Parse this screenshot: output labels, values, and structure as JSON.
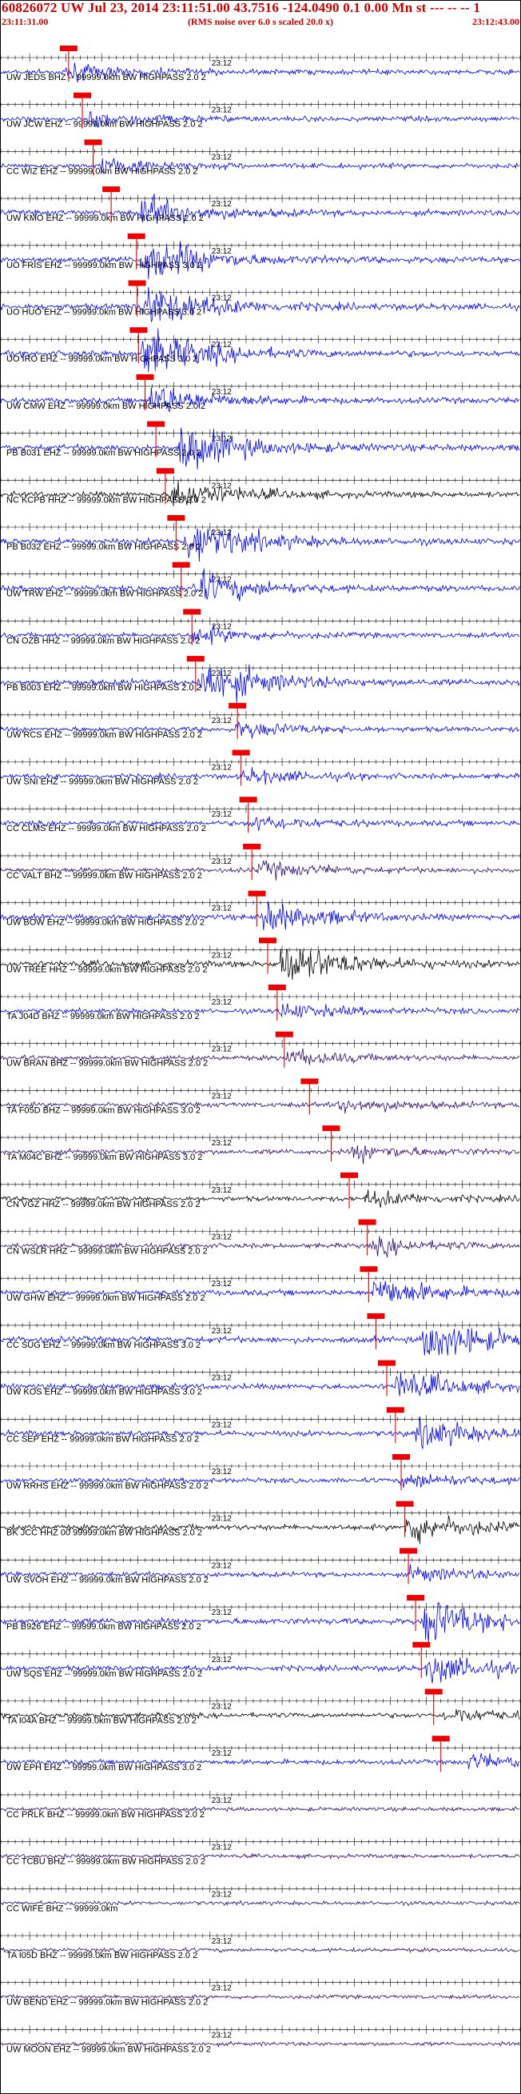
{
  "header": {
    "title": "60826072  UW  Jul 23, 2014 23:11:51.00    43.7516  -124.0490   0.1  0.00  Mn st  ---  --  --  1",
    "start_time": "23:11:31.00",
    "end_time": "23:12:43.00",
    "rms_note": "(RMS noise over 6.0 s scaled 20.0 x)"
  },
  "minute_label": "23:12",
  "colors": {
    "blue": "#0000ee",
    "black": "#000000",
    "purple": "#2a0a6a",
    "pick": "#ee0000",
    "label": "#000000"
  },
  "chart_data": {
    "type": "seismogram record section",
    "x_unit": "time (UTC)",
    "x_range": [
      "23:11:31.00",
      "23:12:43.00"
    ],
    "traces": [
      {
        "label": "UW JEDS BHZ -- 99999.0km BW  HIGHPASS  2.0  2",
        "color": "blue",
        "pick_time": "23:11:40.4",
        "amplitude": "low",
        "burst_time": "23:11:40.4"
      },
      {
        "label": "UW JCW  EHZ -- 99999.0km BW  HIGHPASS  2.0  2",
        "color": "blue",
        "pick_time": "23:11:42.3",
        "amplitude": "low",
        "burst_time": "23:11:43.5"
      },
      {
        "label": "CC WIZ  EHZ -- 99999.0km BW  HIGHPASS  2.0  2",
        "color": "blue",
        "pick_time": "23:11:43.8",
        "amplitude": "low",
        "burst_time": "23:11:45.0"
      },
      {
        "label": "UW KMO  EHZ -- 99999.0km BW  HIGHPASS  2.0  2",
        "color": "blue",
        "pick_time": "23:11:46.3",
        "amplitude": "medium",
        "burst_time": "23:11:50.8"
      },
      {
        "label": "UO FRIS EHZ -- 99999.0km BW  HIGHPASS  3.0  2",
        "color": "blue",
        "pick_time": "23:11:49.8",
        "amplitude": "high",
        "burst_time": "23:11:51.0"
      },
      {
        "label": "UO HUO  EHZ -- 99999.0km BW  HIGHPASS  3.0  2",
        "color": "blue",
        "pick_time": "23:11:49.9",
        "amplitude": "high",
        "burst_time": "23:11:51.0"
      },
      {
        "label": "UO IRO  EHZ -- 99999.0km BW  HIGHPASS  3.0  2",
        "color": "blue",
        "pick_time": "23:11:50.1",
        "amplitude": "high",
        "burst_time": "23:11:51.0"
      },
      {
        "label": "UW CMW  EHZ -- 99999.0km BW  HIGHPASS  2.0  2",
        "color": "blue",
        "pick_time": "23:11:51.0",
        "amplitude": "medium",
        "burst_time": "23:11:52.0"
      },
      {
        "label": "PB B031 EHZ -- 99999.0km BW  HIGHPASS  2.0  2",
        "color": "blue",
        "pick_time": "23:11:52.5",
        "amplitude": "high",
        "burst_time": "23:11:56.0"
      },
      {
        "label": "NC KCPB HHZ -- 99999.0km BW  HIGHPASS  2.0  2",
        "color": "black",
        "pick_time": "23:11:53.8",
        "amplitude": "medium",
        "burst_time": "23:11:55.0"
      },
      {
        "label": "PB B032 EHZ -- 99999.0km BW  HIGHPASS  2.0  2",
        "color": "blue",
        "pick_time": "23:11:55.3",
        "amplitude": "high",
        "burst_time": "23:11:57.0"
      },
      {
        "label": "UW TRW  EHZ -- 99999.0km BW  HIGHPASS  2.0  2",
        "color": "blue",
        "pick_time": "23:11:56.0",
        "amplitude": "medium",
        "burst_time": "23:11:58.0"
      },
      {
        "label": "CN OZB  HHZ -- 99999.0km BW  HIGHPASS  2.0  2",
        "color": "blue",
        "pick_time": "23:11:57.5",
        "amplitude": "low",
        "burst_time": "23:11:58.0"
      },
      {
        "label": "PB B003 EHZ -- 99999.0km BW  HIGHPASS  2.0  2",
        "color": "blue",
        "pick_time": "23:11:58.0",
        "amplitude": "high",
        "burst_time": "23:11:59.0"
      },
      {
        "label": "UW RCS  EHZ -- 99999.0km BW  HIGHPASS  2.0  2",
        "color": "blue",
        "pick_time": "23:12:03.8",
        "amplitude": "low",
        "burst_time": "23:12:04.0"
      },
      {
        "label": "UW SNI  EHZ -- 99999.0km BW  HIGHPASS  2.0  2",
        "color": "blue",
        "pick_time": "23:12:04.3",
        "amplitude": "low",
        "burst_time": "23:12:05.0"
      },
      {
        "label": "CC CLMS EHZ -- 99999.0km BW  HIGHPASS  2.0  2",
        "color": "blue",
        "pick_time": "23:12:05.3",
        "amplitude": "low",
        "burst_time": "23:12:06.0"
      },
      {
        "label": "CC VALT BHZ -- 99999.0km BW  HIGHPASS  2.0  2",
        "color": "purple",
        "pick_time": "23:12:05.8",
        "amplitude": "low",
        "burst_time": "23:12:07.0"
      },
      {
        "label": "UW BOW  EHZ -- 99999.0km BW  HIGHPASS  2.0  2",
        "color": "blue",
        "pick_time": "23:12:06.5",
        "amplitude": "medium",
        "burst_time": "23:12:07.5"
      },
      {
        "label": "UW TREE HHZ -- 99999.0km BW  HIGHPASS  2.0  2",
        "color": "black",
        "pick_time": "23:12:08.0",
        "amplitude": "high",
        "burst_time": "23:12:10.0"
      },
      {
        "label": "TA J04D BHZ -- 99999.0km BW  HIGHPASS  2.0  2",
        "color": "blue",
        "pick_time": "23:12:09.3",
        "amplitude": "low",
        "burst_time": "23:12:10.0"
      },
      {
        "label": "UW BRAN BHZ -- 99999.0km BW  HIGHPASS  2.0  2",
        "color": "purple",
        "pick_time": "23:12:10.3",
        "amplitude": "low",
        "burst_time": "23:12:11.0"
      },
      {
        "label": "TA F05D BHZ -- 99999.0km BW  HIGHPASS  3.0  2",
        "color": "purple",
        "pick_time": "23:12:13.8",
        "amplitude": "low",
        "burst_time": "23:12:18.0"
      },
      {
        "label": "TA M04C BHZ -- 99999.0km BW  HIGHPASS  3.0  2",
        "color": "purple",
        "pick_time": "23:12:16.8",
        "amplitude": "low",
        "burst_time": "23:12:20.0"
      },
      {
        "label": "CN VGZ  HHZ -- 99999.0km BW  HIGHPASS  2.0  2",
        "color": "black",
        "pick_time": "23:12:19.3",
        "amplitude": "low",
        "burst_time": "23:12:22.0"
      },
      {
        "label": "CN WSLR HHZ -- 99999.0km BW  HIGHPASS  2.0  2",
        "color": "purple",
        "pick_time": "23:12:21.8",
        "amplitude": "low",
        "burst_time": "23:12:23.0"
      },
      {
        "label": "UW GHW  EHZ -- 99999.0km BW  HIGHPASS  2.0  2",
        "color": "blue",
        "pick_time": "23:12:22.0",
        "amplitude": "medium",
        "burst_time": "23:12:23.0"
      },
      {
        "label": "CC SUG  EHZ -- 99999.0km BW  HIGHPASS  3.0  2",
        "color": "blue",
        "pick_time": "23:12:23.0",
        "amplitude": "high",
        "burst_time": "23:12:30.0"
      },
      {
        "label": "UW KOS  EHZ -- 99999.0km BW  HIGHPASS  3.0  2",
        "color": "blue",
        "pick_time": "23:12:24.5",
        "amplitude": "medium",
        "burst_time": "23:12:26.0"
      },
      {
        "label": "CC SEP  EHZ -- 99999.0km BW  HIGHPASS  2.0  2",
        "color": "blue",
        "pick_time": "23:12:25.7",
        "amplitude": "medium",
        "burst_time": "23:12:29.0"
      },
      {
        "label": "UW RRHS EHZ -- 99999.0km BW  HIGHPASS  2.0  2",
        "color": "blue",
        "pick_time": "23:12:26.5",
        "amplitude": "low",
        "burst_time": "23:12:27.0"
      },
      {
        "label": "BK JCC  HHZ 00 99999.0km BW  HIGHPASS  2.0  2",
        "color": "black",
        "pick_time": "23:12:27.0",
        "amplitude": "medium",
        "burst_time": "23:12:27.5"
      },
      {
        "label": "UW SVOH EHZ -- 99999.0km BW  HIGHPASS  2.0  2",
        "color": "blue",
        "pick_time": "23:12:27.5",
        "amplitude": "low",
        "burst_time": "23:12:28.0"
      },
      {
        "label": "PB B926 EHZ -- 99999.0km BW  HIGHPASS  2.0  2",
        "color": "blue",
        "pick_time": "23:12:28.5",
        "amplitude": "high",
        "burst_time": "23:12:30.0"
      },
      {
        "label": "UW SQS  EHZ -- 99999.0km BW  HIGHPASS  2.0  2",
        "color": "blue",
        "pick_time": "23:12:29.3",
        "amplitude": "medium",
        "burst_time": "23:12:30.5"
      },
      {
        "label": "TA I04A BHZ -- 99999.0km BW  HIGHPASS  2.0  2",
        "color": "black",
        "pick_time": "23:12:31.0",
        "amplitude": "low",
        "burst_time": "23:12:33.0"
      },
      {
        "label": "UW EPH  EHZ -- 99999.0km BW  HIGHPASS  3.0  2",
        "color": "blue",
        "pick_time": "23:12:32.0",
        "amplitude": "low",
        "burst_time": "23:12:36.0"
      },
      {
        "label": "CC PRLK BHZ -- 99999.0km BW  HIGHPASS  2.0  2",
        "color": "purple",
        "pick_time": null,
        "amplitude": "noise",
        "burst_time": null
      },
      {
        "label": "CC TCBU BHZ -- 99999.0km BW  HIGHPASS  2.0  2",
        "color": "purple",
        "pick_time": null,
        "amplitude": "noise",
        "burst_time": null
      },
      {
        "label": "CC WIFE BHZ -- 99999.0km",
        "color": "purple",
        "pick_time": null,
        "amplitude": "noise",
        "burst_time": null
      },
      {
        "label": "TA I05D BHZ -- 99999.0km BW  HIGHPASS  2.0  2",
        "color": "purple",
        "pick_time": null,
        "amplitude": "noise",
        "burst_time": null
      },
      {
        "label": "UW BEND EHZ -- 99999.0km BW  HIGHPASS  2.0  2",
        "color": "purple",
        "pick_time": null,
        "amplitude": "noise",
        "burst_time": null
      },
      {
        "label": "UW MOON EHZ -- 99999.0km BW  HIGHPASS  2.0  2",
        "color": "purple",
        "pick_time": null,
        "amplitude": "noise",
        "burst_time": null
      }
    ]
  }
}
